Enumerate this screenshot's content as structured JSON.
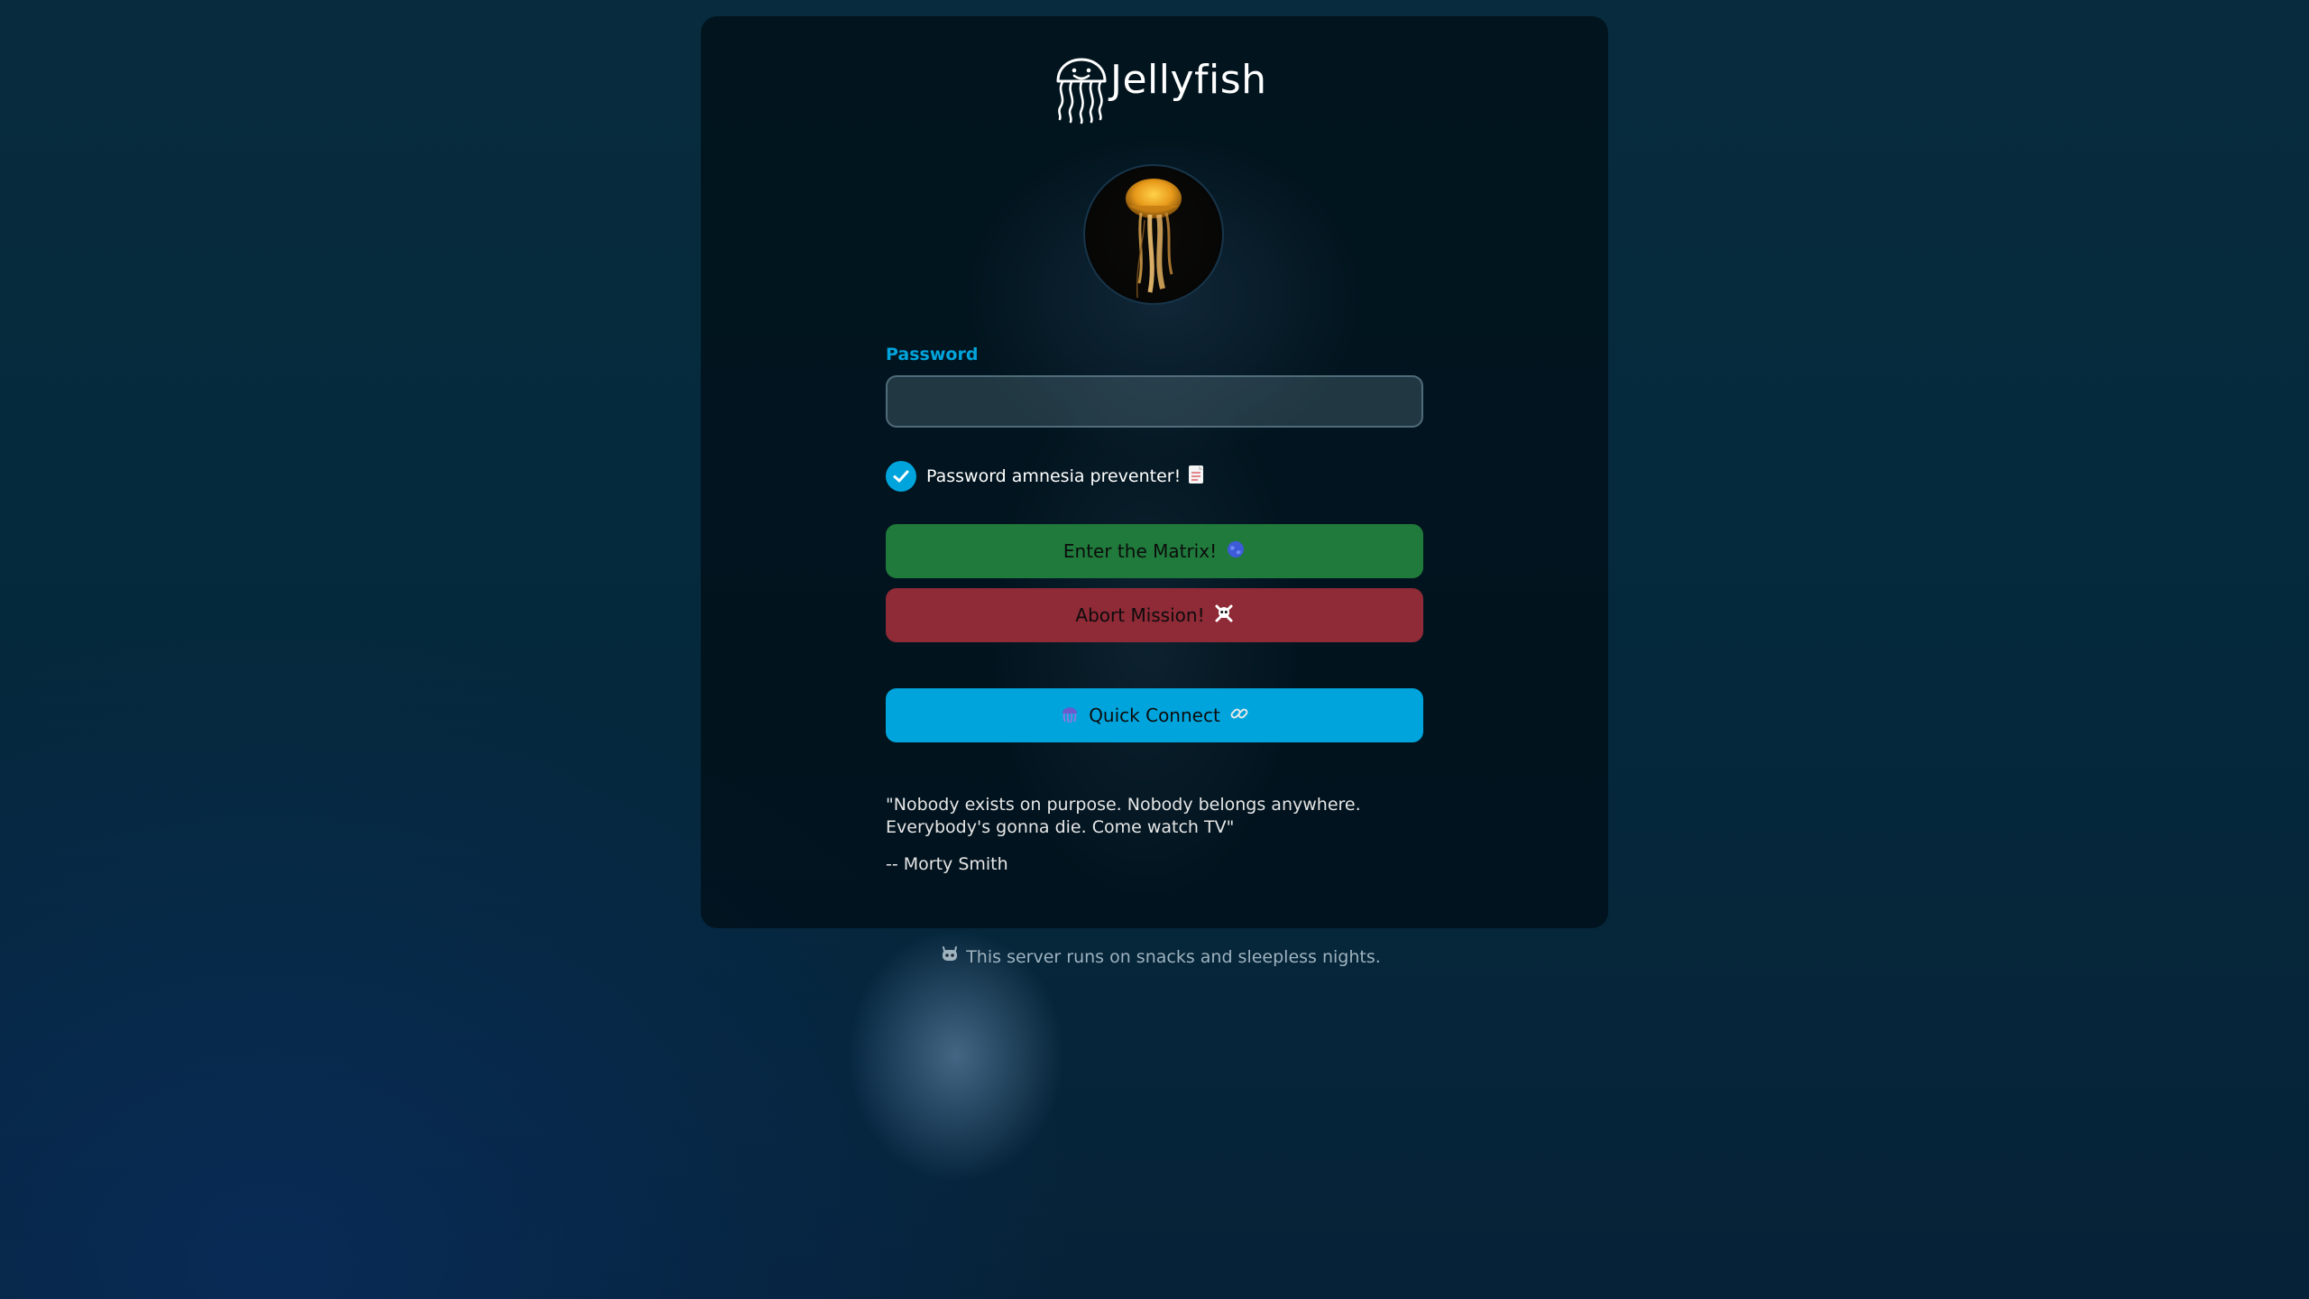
{
  "app": {
    "logo_text": "Jellyfish",
    "logo_icon": "jellyfish-icon"
  },
  "avatar": {
    "description_icon": "jellyfish-avatar-image"
  },
  "form": {
    "password_label": "Password",
    "password_value": "",
    "remember_label": "Password amnesia preventer!",
    "remember_checked": true,
    "remember_icon": "memo-icon",
    "enter_button": "Enter the Matrix!",
    "enter_icon": "globe-icon",
    "abort_button": "Abort Mission!",
    "abort_icon": "skull-crossbones-icon",
    "quick_connect_button": "Quick Connect",
    "quick_connect_left_icon": "jellyfish-emoji-icon",
    "quick_connect_right_icon": "link-icon"
  },
  "quote": {
    "text": "\"Nobody exists on purpose. Nobody belongs anywhere. Everybody's gonna die. Come watch TV\"",
    "author": "-- Morty Smith"
  },
  "footer": {
    "icon": "robot-icon",
    "text": "This server runs on snacks and sleepless nights."
  },
  "colors": {
    "accent": "#00a4dc",
    "enter_button": "#1f7a3b",
    "abort_button": "#8f2a37",
    "quick_connect_button": "#00a4dc"
  }
}
